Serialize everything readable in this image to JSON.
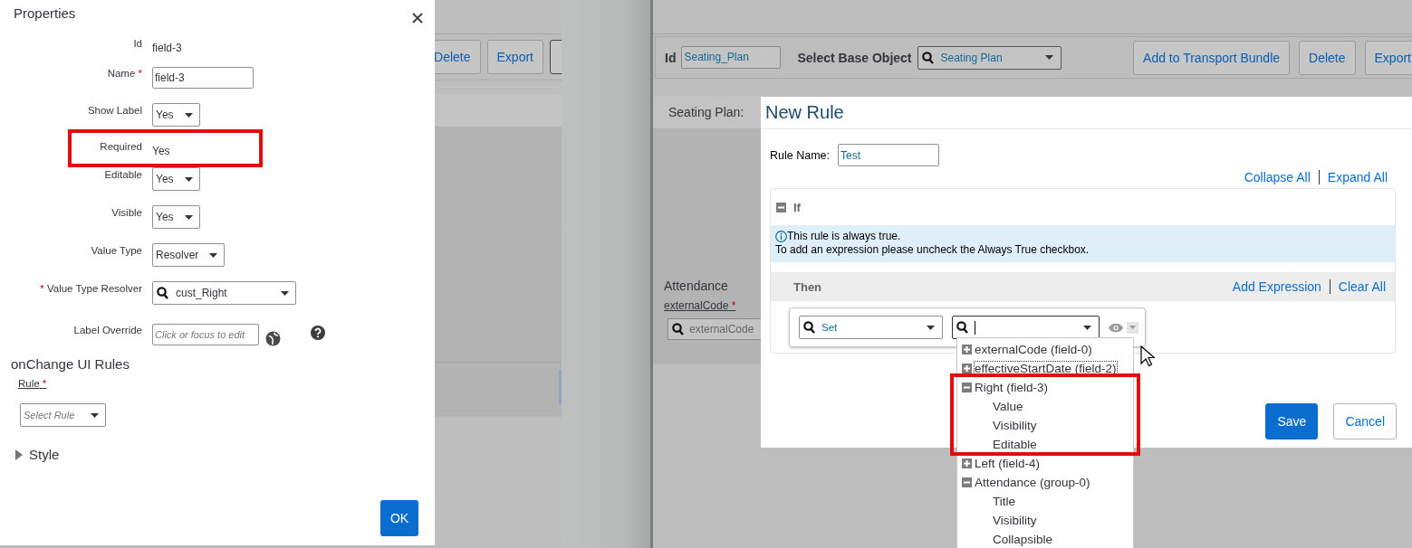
{
  "properties_panel": {
    "title": "Properties",
    "rows": [
      {
        "kind": "text",
        "label": "Id",
        "value": "field-3",
        "highlighted": false
      },
      {
        "kind": "input",
        "label": "Name",
        "star_after": "*",
        "value": "field-3",
        "highlighted": false
      },
      {
        "kind": "select",
        "label": "Show Label",
        "value": "Yes",
        "highlighted": false
      },
      {
        "kind": "text",
        "label": "Required",
        "value": "Yes",
        "highlighted": true
      },
      {
        "kind": "select",
        "label": "Editable",
        "value": "Yes",
        "highlighted": false
      },
      {
        "kind": "select",
        "label": "Visible",
        "value": "Yes",
        "highlighted": false
      },
      {
        "kind": "select",
        "label": "Value Type",
        "value": "Resolver",
        "highlighted": false
      },
      {
        "kind": "search-select",
        "label": "Value Type Resolver",
        "star_before": "*",
        "value": "cust_Right",
        "highlighted": false
      },
      {
        "kind": "input",
        "label": "Label Override",
        "placeholder": "Click or focus to edit",
        "highlighted": false
      }
    ],
    "section_title": "onChange UI Rules",
    "rule_label": "Rule",
    "rule_star": "*",
    "rule_select_placeholder": "Select Rule",
    "style_section": {
      "label": "Style",
      "expanded": false
    },
    "ok_button": "OK"
  },
  "background_left": {
    "buttons": [
      "Delete",
      "Export"
    ]
  },
  "background_right": {
    "id_label": "Id",
    "id_value": "Seating_Plan",
    "base_object_label": "Select Base Object",
    "base_object_value": "Seating Plan",
    "buttons": [
      "Add to Transport Bundle",
      "Delete",
      "Export"
    ],
    "section_title": "Seating Plan:",
    "group_title": "Attendance",
    "field_label": "externalCode",
    "field_star": "*",
    "field_placeholder": "externalCode"
  },
  "new_rule_dialog": {
    "title": "New Rule",
    "rule_name_label": "Rule Name:",
    "rule_name_value": "Test",
    "links": [
      "Collapse All",
      "Expand All"
    ],
    "if_section": {
      "label": "If",
      "expanded": true,
      "info_lines": [
        "This rule is always true.",
        "To add an expression please uncheck the Always True checkbox."
      ]
    },
    "then_section": {
      "label": "Then",
      "links": [
        "Add Expression",
        "Clear All"
      ],
      "action_value": "Set"
    },
    "buttons": [
      {
        "label": "Save",
        "kind": "primary"
      },
      {
        "label": "Cancel",
        "kind": "secondary"
      }
    ]
  },
  "field_dropdown": {
    "items": [
      {
        "label": "externalCode (field-0)",
        "expanded": false,
        "focused": false,
        "highlighted": false
      },
      {
        "label": "effectiveStartDate (field-2)",
        "expanded": false,
        "focused": true,
        "highlighted": false
      },
      {
        "label": "Right (field-3)",
        "expanded": true,
        "focused": false,
        "highlighted": true,
        "children": [
          {
            "label": "Value"
          },
          {
            "label": "Visibility"
          },
          {
            "label": "Editable"
          }
        ]
      },
      {
        "label": "Left (field-4)",
        "expanded": false,
        "focused": false,
        "highlighted": false
      },
      {
        "label": "Attendance (group-0)",
        "expanded": true,
        "focused": false,
        "highlighted": false,
        "children": [
          {
            "label": "Title"
          },
          {
            "label": "Visibility"
          },
          {
            "label": "Collapsible"
          }
        ]
      }
    ]
  }
}
